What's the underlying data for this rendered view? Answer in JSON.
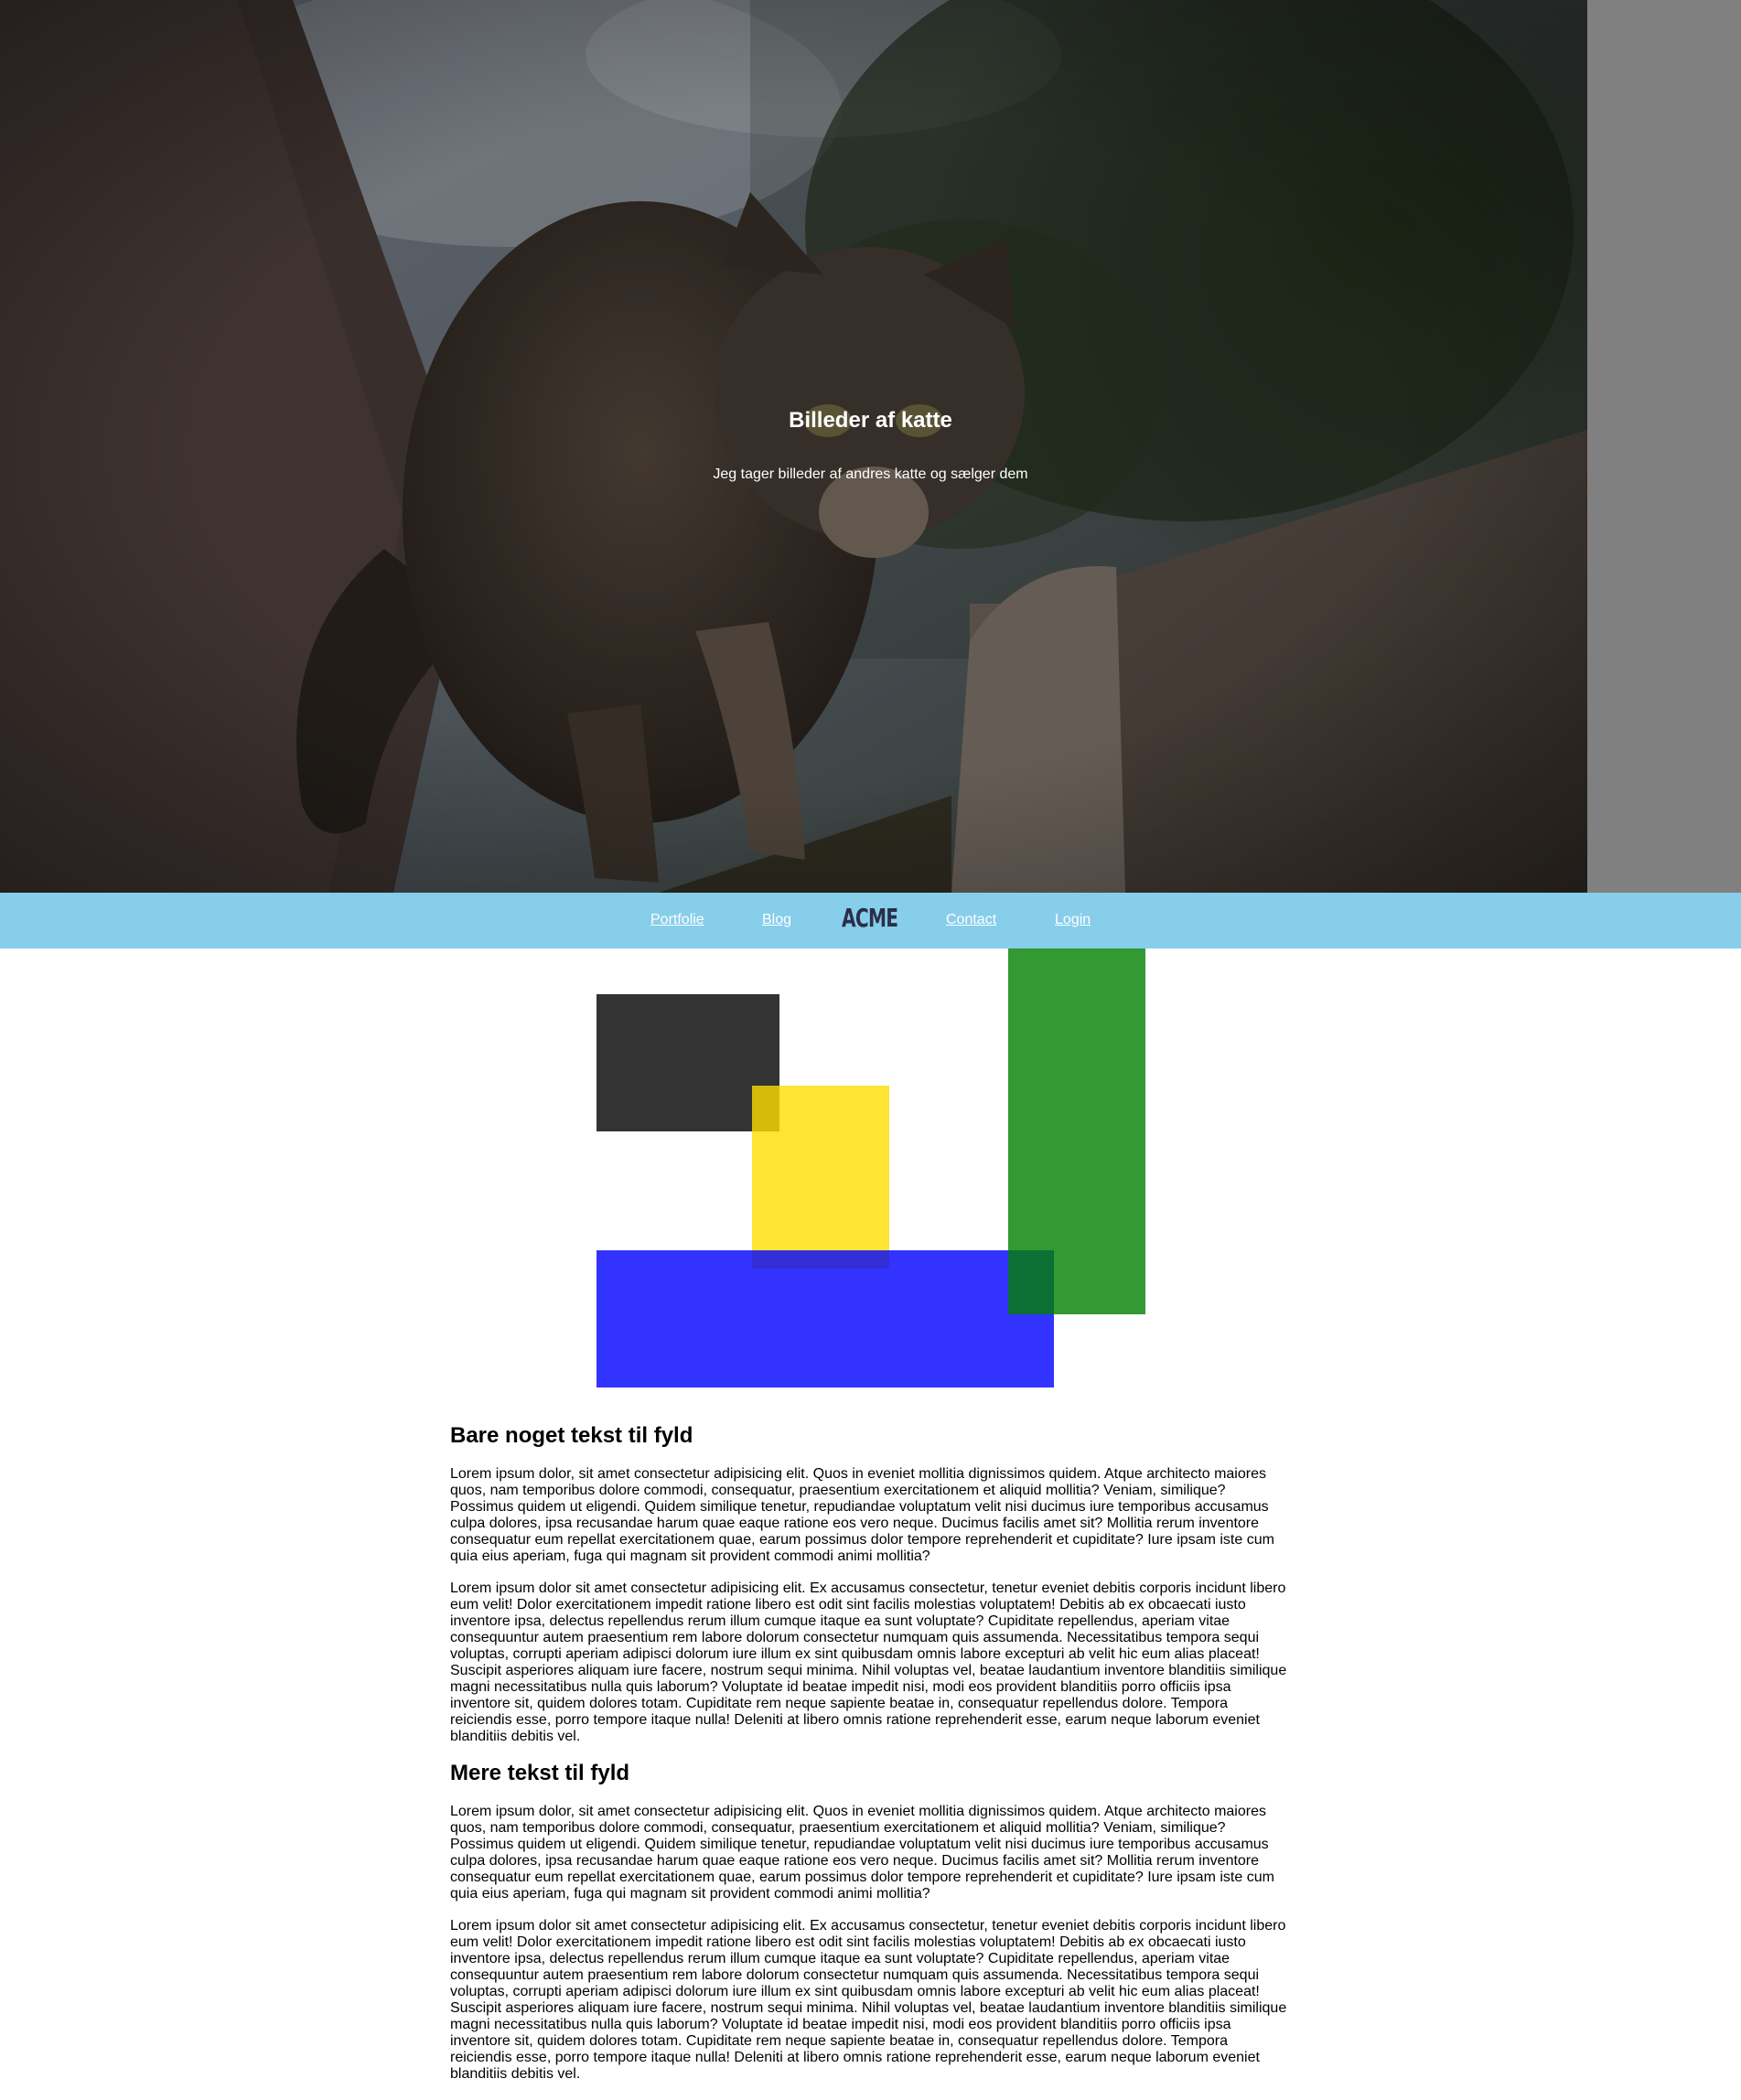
{
  "hero": {
    "title": "Billeder af katte",
    "subtitle": "Jeg tager billeder af andres katte og sælger dem"
  },
  "nav": {
    "links": [
      "Portfolie",
      "Blog",
      "Contact",
      "Login"
    ],
    "logo": "ACME",
    "background": "#87ceeb"
  },
  "shapes": {
    "black": "#333333",
    "yellow": "#ffe033",
    "blue": "#3333ff",
    "green": "#339933"
  },
  "sections": [
    {
      "heading": "Bare noget tekst til fyld",
      "paragraphs": [
        "Lorem ipsum dolor, sit amet consectetur adipisicing elit. Quos in eveniet mollitia dignissimos quidem. Atque architecto maiores quos, nam temporibus dolore commodi, consequatur, praesentium exercitationem et aliquid mollitia? Veniam, similique? Possimus quidem ut eligendi. Quidem similique tenetur, repudiandae voluptatum velit nisi ducimus iure temporibus accusamus culpa dolores, ipsa recusandae harum quae eaque ratione eos vero neque. Ducimus facilis amet sit? Mollitia rerum inventore consequatur eum repellat exercitationem quae, earum possimus dolor tempore reprehenderit et cupiditate? Iure ipsam iste cum quia eius aperiam, fuga qui magnam sit provident commodi animi mollitia?",
        "Lorem ipsum dolor sit amet consectetur adipisicing elit. Ex accusamus consectetur, tenetur eveniet debitis corporis incidunt libero eum velit! Dolor exercitationem impedit ratione libero est odit sint facilis molestias voluptatem! Debitis ab ex obcaecati iusto inventore ipsa, delectus repellendus rerum illum cumque itaque ea sunt voluptate? Cupiditate repellendus, aperiam vitae consequuntur autem praesentium rem labore dolorum consectetur numquam quis assumenda. Necessitatibus tempora sequi voluptas, corrupti aperiam adipisci dolorum iure illum ex sint quibusdam omnis labore excepturi ab velit hic eum alias placeat! Suscipit asperiores aliquam iure facere, nostrum sequi minima. Nihil voluptas vel, beatae laudantium inventore blanditiis similique magni necessitatibus nulla quis laborum? Voluptate id beatae impedit nisi, modi eos provident blanditiis porro officiis ipsa inventore sit, quidem dolores totam. Cupiditate rem neque sapiente beatae in, consequatur repellendus dolore. Tempora reiciendis esse, porro tempore itaque nulla! Deleniti at libero omnis ratione reprehenderit esse, earum neque laborum eveniet blanditiis debitis vel."
      ]
    },
    {
      "heading": "Mere tekst til fyld",
      "paragraphs": [
        "Lorem ipsum dolor, sit amet consectetur adipisicing elit. Quos in eveniet mollitia dignissimos quidem. Atque architecto maiores quos, nam temporibus dolore commodi, consequatur, praesentium exercitationem et aliquid mollitia? Veniam, similique? Possimus quidem ut eligendi. Quidem similique tenetur, repudiandae voluptatum velit nisi ducimus iure temporibus accusamus culpa dolores, ipsa recusandae harum quae eaque ratione eos vero neque. Ducimus facilis amet sit? Mollitia rerum inventore consequatur eum repellat exercitationem quae, earum possimus dolor tempore reprehenderit et cupiditate? Iure ipsam iste cum quia eius aperiam, fuga qui magnam sit provident commodi animi mollitia?",
        "Lorem ipsum dolor sit amet consectetur adipisicing elit. Ex accusamus consectetur, tenetur eveniet debitis corporis incidunt libero eum velit! Dolor exercitationem impedit ratione libero est odit sint facilis molestias voluptatem! Debitis ab ex obcaecati iusto inventore ipsa, delectus repellendus rerum illum cumque itaque ea sunt voluptate? Cupiditate repellendus, aperiam vitae consequuntur autem praesentium rem labore dolorum consectetur numquam quis assumenda. Necessitatibus tempora sequi voluptas, corrupti aperiam adipisci dolorum iure illum ex sint quibusdam omnis labore excepturi ab velit hic eum alias placeat! Suscipit asperiores aliquam iure facere, nostrum sequi minima. Nihil voluptas vel, beatae laudantium inventore blanditiis similique magni necessitatibus nulla quis laborum? Voluptate id beatae impedit nisi, modi eos provident blanditiis porro officiis ipsa inventore sit, quidem dolores totam. Cupiditate rem neque sapiente beatae in, consequatur repellendus dolore. Tempora reiciendis esse, porro tempore itaque nulla! Deleniti at libero omnis ratione reprehenderit esse, earum neque laborum eveniet blanditiis debitis vel."
      ]
    }
  ]
}
